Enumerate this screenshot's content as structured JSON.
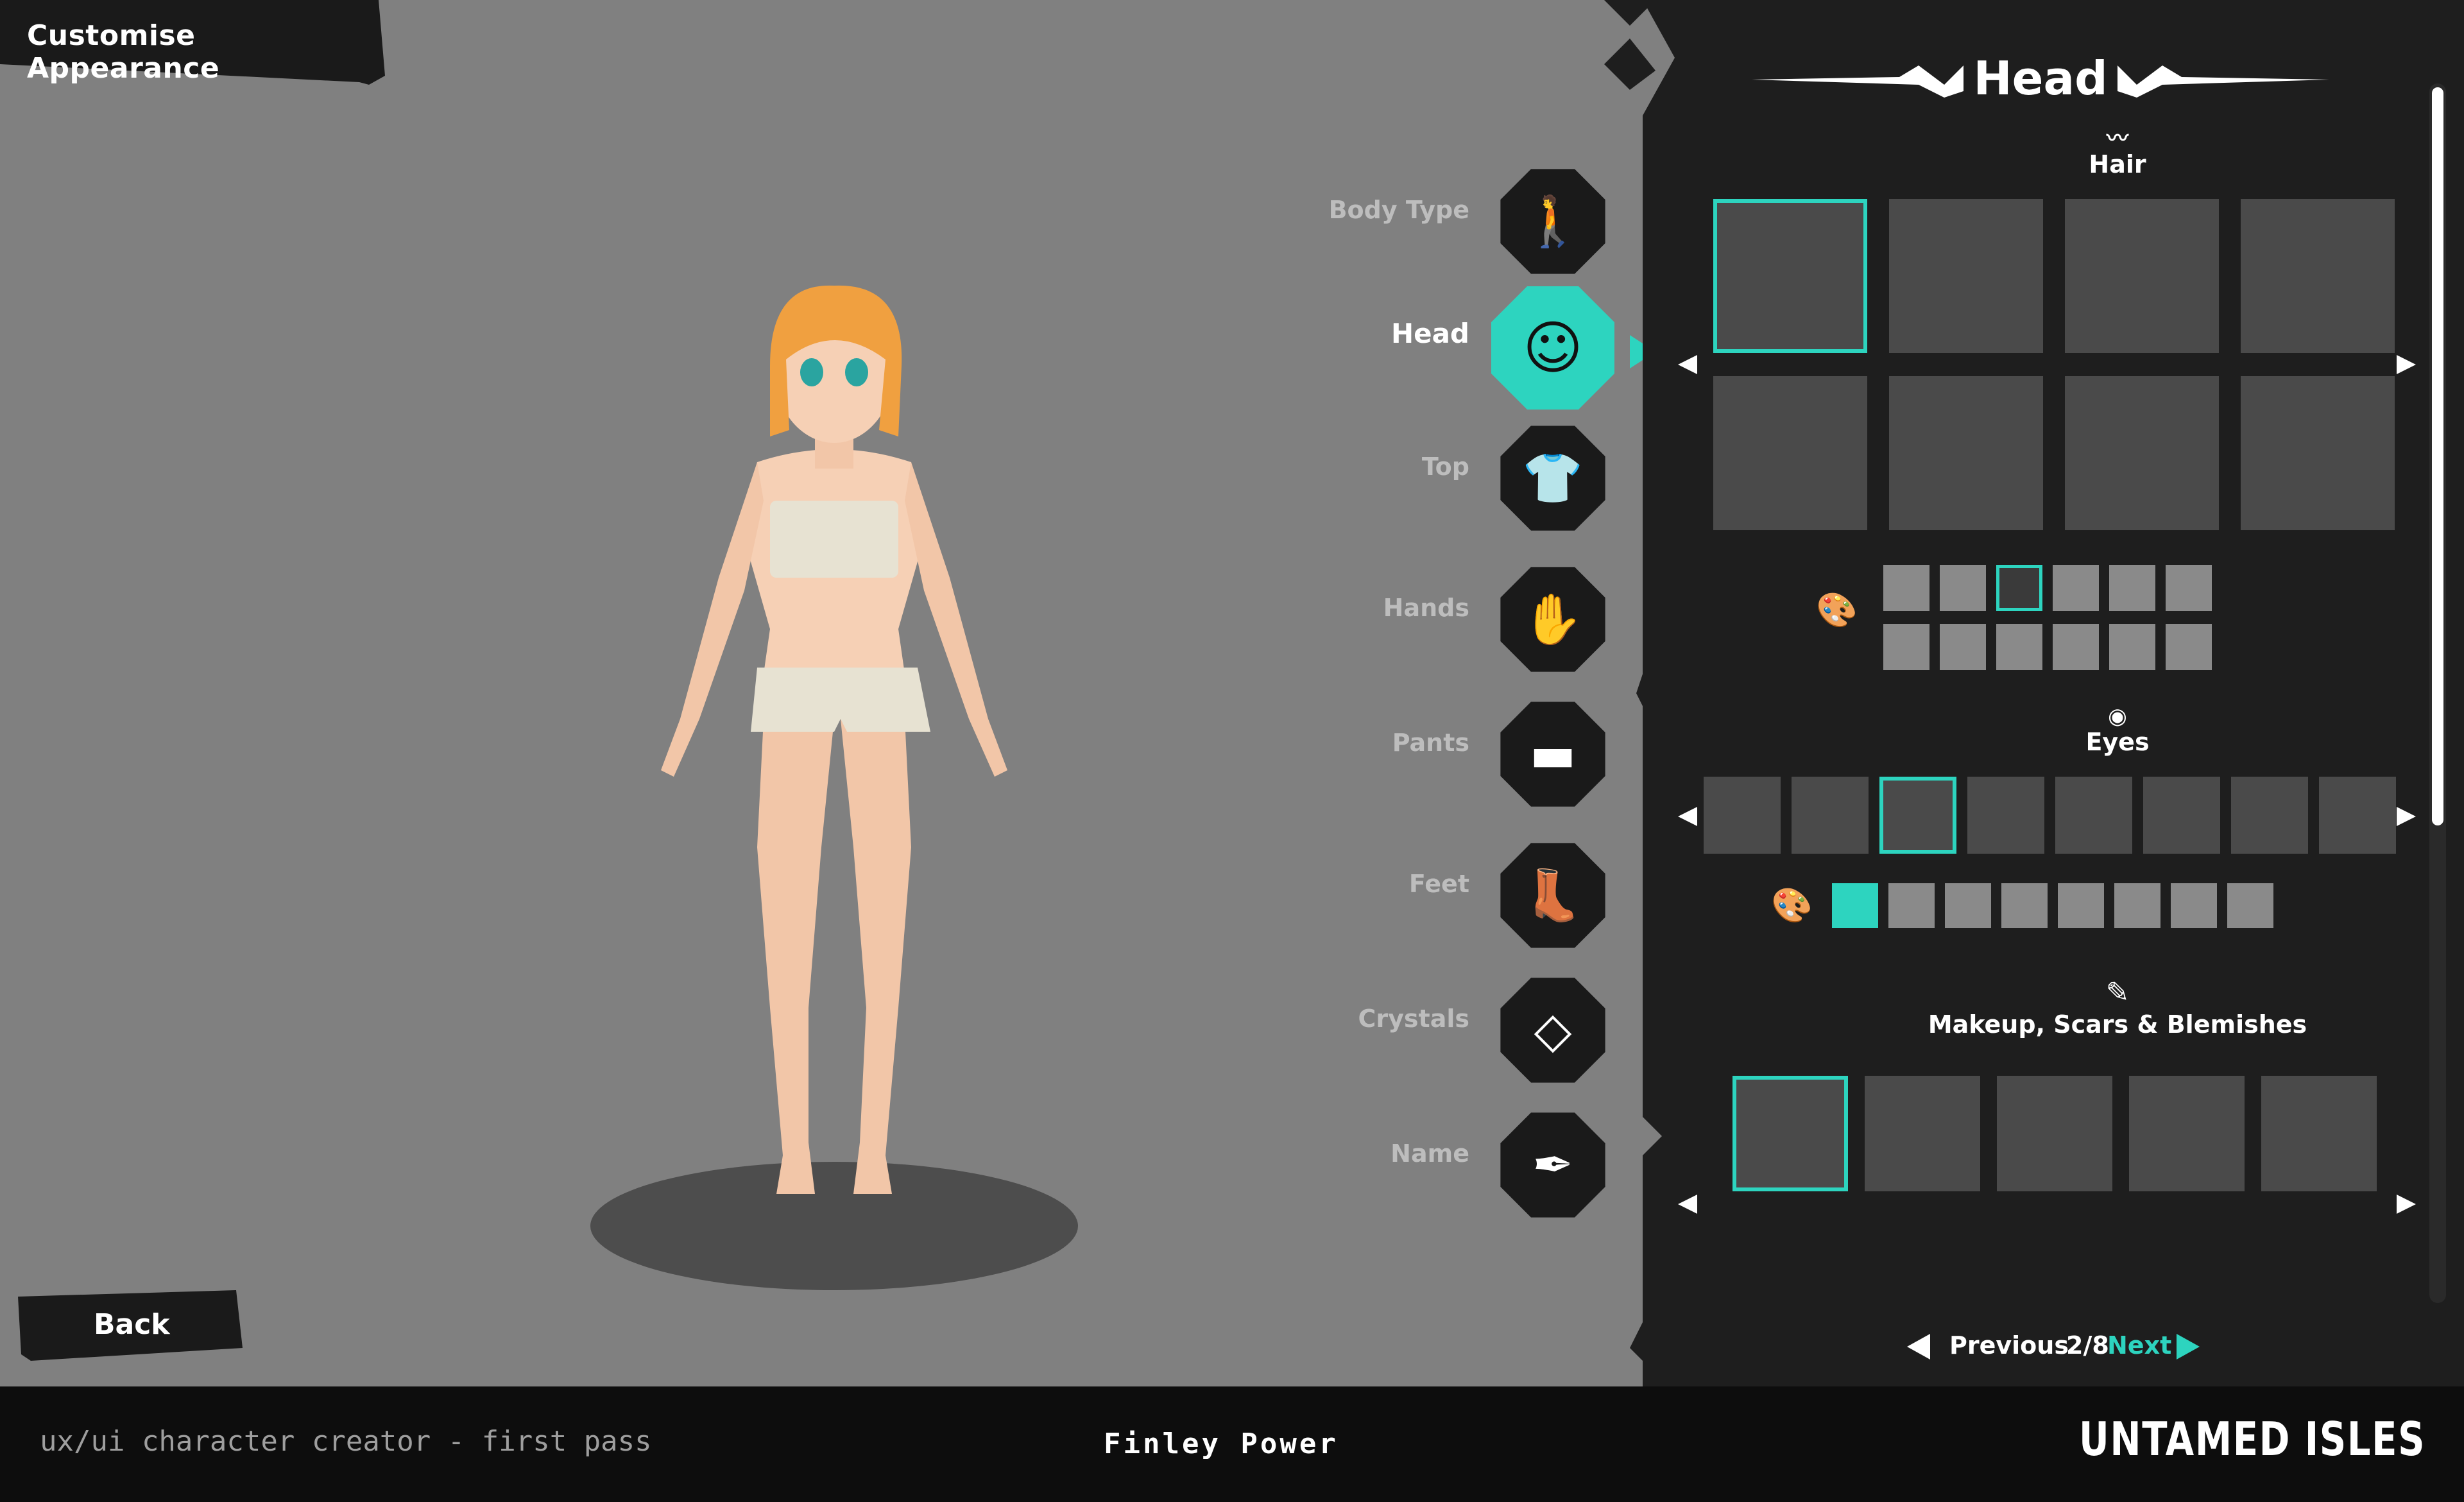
{
  "header": {
    "title": "Customise Appearance"
  },
  "categories": [
    {
      "label": "Body Type",
      "icon": "body-type-icon",
      "active": false
    },
    {
      "label": "Head",
      "icon": "head-icon",
      "active": true
    },
    {
      "label": "Top",
      "icon": "top-shirt-icon",
      "active": false
    },
    {
      "label": "Hands",
      "icon": "hands-glove-icon",
      "active": false
    },
    {
      "label": "Pants",
      "icon": "pants-icon",
      "active": false
    },
    {
      "label": "Feet",
      "icon": "feet-boots-icon",
      "active": false
    },
    {
      "label": "Crystals",
      "icon": "crystal-icon",
      "active": false
    },
    {
      "label": "Name",
      "icon": "name-quill-icon",
      "active": false
    }
  ],
  "panel": {
    "title": "Head",
    "hair": {
      "label": "Hair",
      "icon": "hair-icon",
      "selected_index": 0,
      "tile_count": 8,
      "color_swatch_count": 12,
      "selected_color": 2
    },
    "eyes": {
      "label": "Eyes",
      "icon": "eye-icon",
      "selected_index": 2,
      "tile_count": 8,
      "color_swatch_count": 8,
      "selected_color": 0
    },
    "makeup": {
      "label": "Makeup, Scars & Blemishes",
      "icon": "makeup-brush-icon",
      "selected_index": 0,
      "tile_count": 5
    },
    "pagination": {
      "previous_label": "Previous",
      "page": "2/8",
      "next_label": "Next"
    }
  },
  "back_button": {
    "label": "Back"
  },
  "footer": {
    "left_text": "ux/ui character creator - first pass",
    "author": "Finley Power",
    "logo": "UNTAMED ISLES"
  },
  "colors": {
    "accent": "#2dd4bf",
    "panel_bg": "#1e1e1e",
    "tile": "#4a4a4a",
    "canvas": "#808080"
  }
}
